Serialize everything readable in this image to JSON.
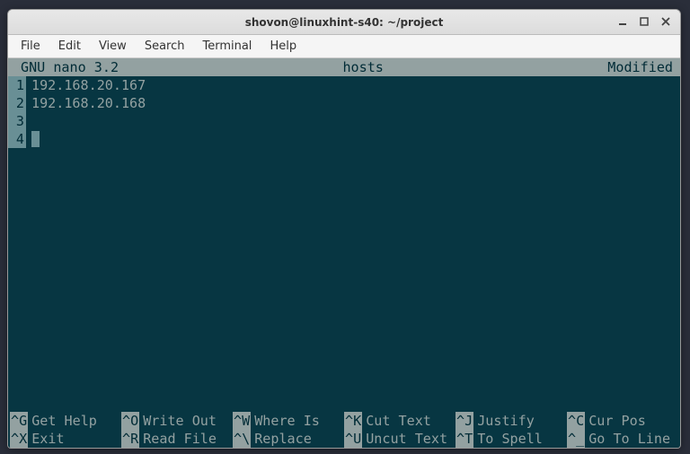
{
  "window": {
    "title": "shovon@linuxhint-s40: ~/project"
  },
  "menubar": {
    "items": [
      "File",
      "Edit",
      "View",
      "Search",
      "Terminal",
      "Help"
    ]
  },
  "nano": {
    "header_left": "GNU nano 3.2",
    "header_center": "hosts",
    "header_right": "Modified"
  },
  "editor": {
    "lines": [
      "192.168.20.167",
      "192.168.20.168",
      "",
      ""
    ],
    "line_numbers": [
      "1",
      "2",
      "3",
      "4"
    ],
    "cursor_line_index": 3
  },
  "footer": {
    "row1": [
      {
        "key": "^G",
        "label": "Get Help"
      },
      {
        "key": "^O",
        "label": "Write Out"
      },
      {
        "key": "^W",
        "label": "Where Is"
      },
      {
        "key": "^K",
        "label": "Cut Text"
      },
      {
        "key": "^J",
        "label": "Justify"
      },
      {
        "key": "^C",
        "label": "Cur Pos"
      }
    ],
    "row2": [
      {
        "key": "^X",
        "label": "Exit"
      },
      {
        "key": "^R",
        "label": "Read File"
      },
      {
        "key": "^\\",
        "label": "Replace"
      },
      {
        "key": "^U",
        "label": "Uncut Text"
      },
      {
        "key": "^T",
        "label": "To Spell"
      },
      {
        "key": "^_",
        "label": "Go To Line"
      }
    ]
  }
}
